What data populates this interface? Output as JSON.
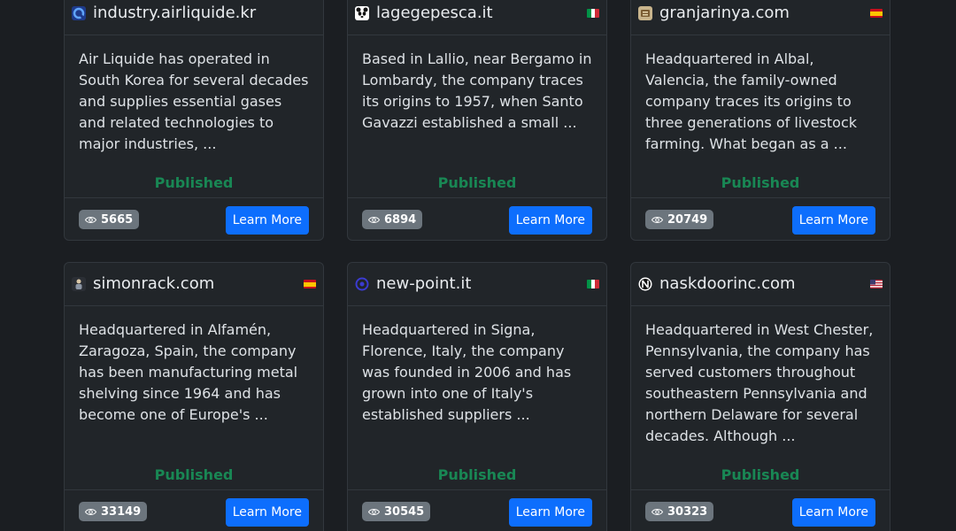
{
  "cards": [
    {
      "domain": "industry.airliquide.kr",
      "favicon_icon": "airliquide-logo-icon",
      "flag_icon": null,
      "description": "Air Liquide has operated in South Korea for several decades and supplies essential gases and related technologies to major industries, ...",
      "status": "Published",
      "views": "5665",
      "button_label": "Learn More"
    },
    {
      "domain": "lagegepesca.it",
      "favicon_icon": "panda-logo-icon",
      "flag_icon": "italy-flag-icon",
      "description": "Based in Lallio, near Bergamo in Lombardy, the company traces its origins to 1957, when Santo Gavazzi established a small ...",
      "status": "Published",
      "views": "6894",
      "button_label": "Learn More"
    },
    {
      "domain": "granjarinya.com",
      "favicon_icon": "granjarinya-logo-icon",
      "flag_icon": "spain-flag-icon",
      "description": "Headquartered in Albal, Valencia, the family-owned company traces its origins to three generations of livestock farming. What began as a ...",
      "status": "Published",
      "views": "20749",
      "button_label": "Learn More"
    },
    {
      "domain": "simonrack.com",
      "favicon_icon": "simonrack-logo-icon",
      "flag_icon": "spain-flag-icon",
      "description": "Headquartered in Alfamén, Zaragoza, Spain, the company has been manufacturing metal shelving since 1964 and has become one of Europe's ...",
      "status": "Published",
      "views": "33149",
      "button_label": "Learn More"
    },
    {
      "domain": "new-point.it",
      "favicon_icon": "newpoint-logo-icon",
      "flag_icon": "italy-flag-icon",
      "description": "Headquartered in Signa, Florence, Italy, the company was founded in 2006 and has grown into one of Italy's established suppliers ...",
      "status": "Published",
      "views": "30545",
      "button_label": "Learn More"
    },
    {
      "domain": "naskdoorinc.com",
      "favicon_icon": "naskdoor-logo-icon",
      "flag_icon": "usa-flag-icon",
      "description": "Headquartered in West Chester, Pennsylvania, the company has served customers throughout southeastern Pennsylvania and northern Delaware for several decades. Although ...",
      "status": "Published",
      "views": "30323",
      "button_label": "Learn More"
    }
  ],
  "colors": {
    "page_bg": "#1b1e22",
    "card_bg": "#212529",
    "published": "#198754",
    "button": "#0d6efd",
    "badge": "#6c757d"
  }
}
